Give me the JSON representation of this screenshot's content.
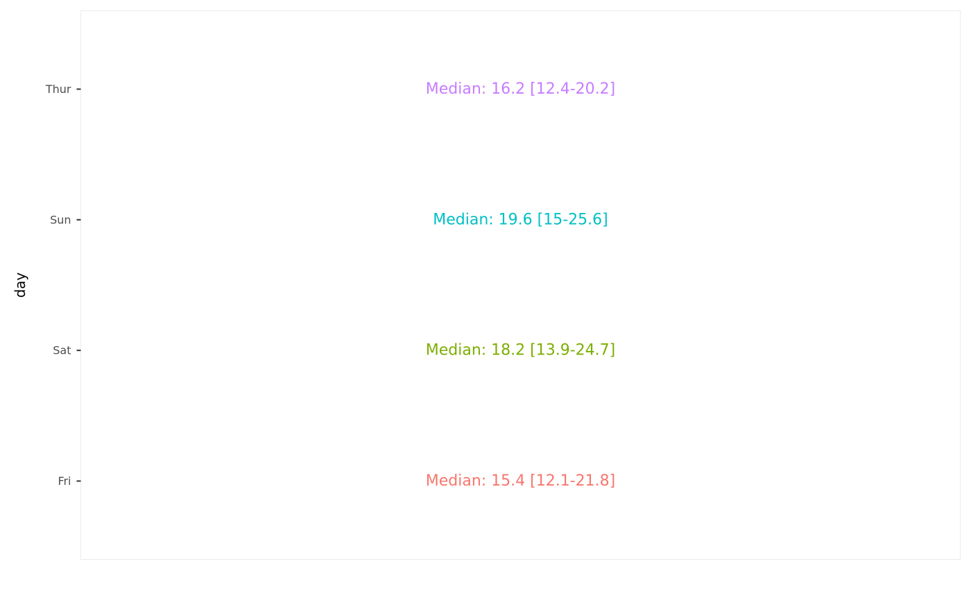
{
  "chart_data": {
    "type": "text",
    "ylabel": "day",
    "xlabel": "",
    "title": "",
    "categories": [
      "Fri",
      "Sat",
      "Sun",
      "Thur"
    ],
    "labels": [
      {
        "category": "Thur",
        "text": "Median: 16.2 [12.4-20.2]",
        "color": "#C77CFF"
      },
      {
        "category": "Sun",
        "text": "Median: 19.6 [15-25.6]",
        "color": "#00BFC4"
      },
      {
        "category": "Sat",
        "text": "Median: 18.2 [13.9-24.7]",
        "color": "#7CAE00"
      },
      {
        "category": "Fri",
        "text": "Median: 15.4 [12.1-21.8]",
        "color": "#F8766D"
      }
    ],
    "grid": false,
    "legend": "none"
  }
}
